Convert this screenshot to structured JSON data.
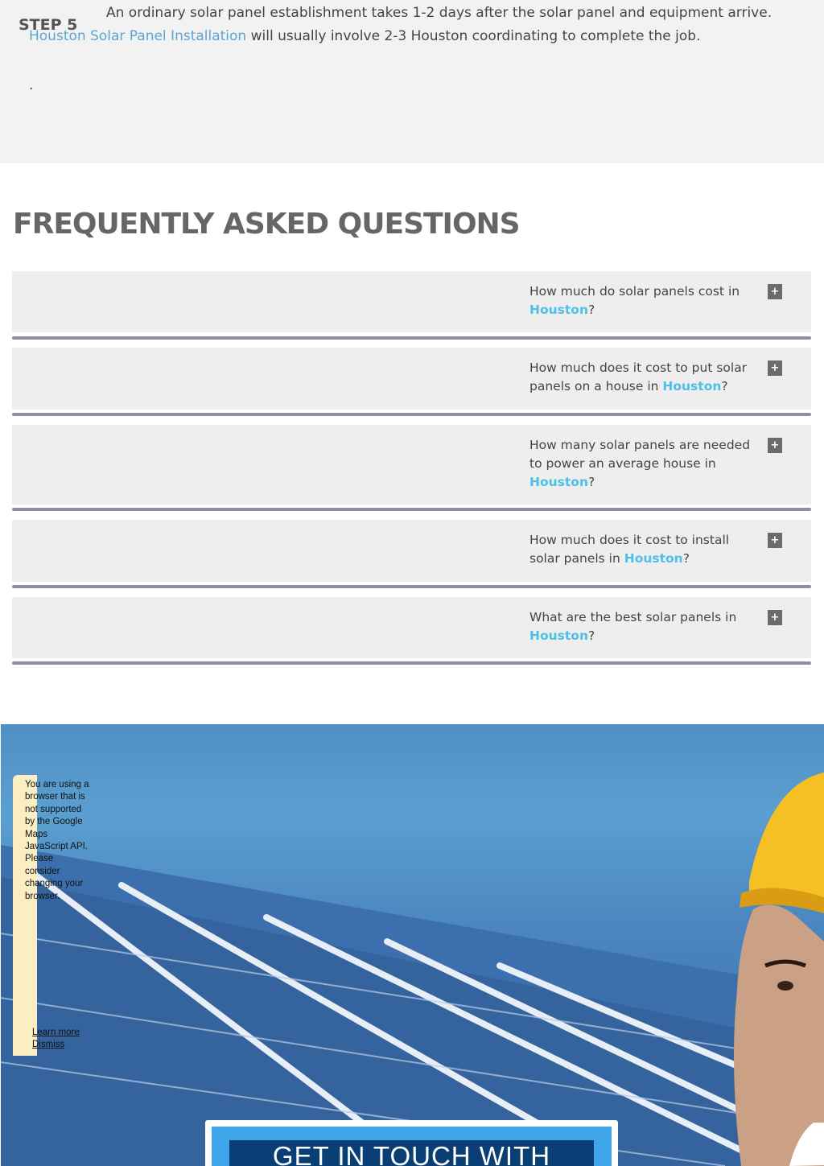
{
  "step": {
    "label": "STEP 5",
    "text_before": "An ordinary solar panel establishment takes 1-2 days after the solar panel and equipment arrive. ",
    "link": "Houston Solar Panel Installation",
    "text_after": " will usually involve 2-3 Houston coordinating to complete the job.",
    "dot": "."
  },
  "faq": {
    "heading": "FREQUENTLY ASKED QUESTIONS",
    "plus_symbol": "+",
    "items": [
      {
        "question": "How much do solar panels cost in ",
        "city": "Houston",
        "suffix": "?"
      },
      {
        "question": "How much does it cost to put solar panels on a house in ",
        "city": "Houston",
        "suffix": "?"
      },
      {
        "question": "How many solar panels are needed to power an average house in ",
        "city": "Houston",
        "suffix": "?"
      },
      {
        "question": "How much does it cost to install solar panels in ",
        "city": "Houston",
        "suffix": "?"
      },
      {
        "question": "What are the best solar panels in ",
        "city": "Houston",
        "suffix": "?"
      }
    ]
  },
  "maps_warning": {
    "text": "You are using a browser that is not supported by the Google Maps JavaScript API. Please consider changing your browser.",
    "learn_more": "Learn more",
    "dismiss": "Dismiss"
  },
  "contact": {
    "title": "GET IN TOUCH WITH"
  },
  "colors": {
    "link": "#5aa6d3",
    "city_highlight": "#4ebfe8",
    "faq_divider": "#8c919e",
    "contact_inner": "#3fa5ea",
    "contact_title_bg": "#0a3f75"
  }
}
